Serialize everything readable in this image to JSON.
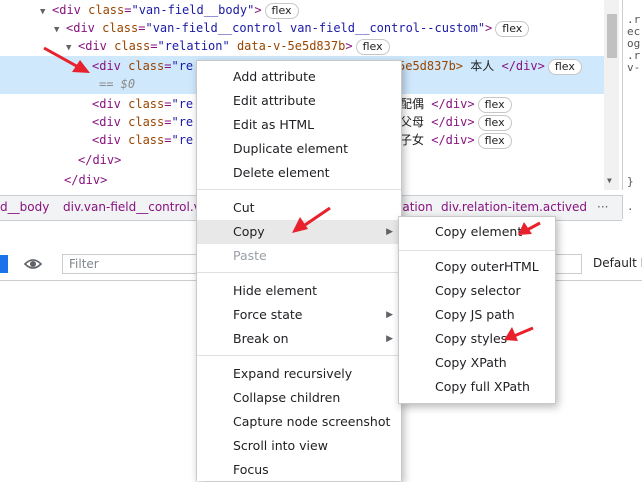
{
  "tree": {
    "line1": {
      "tag_open": "<div ",
      "attr": "class",
      "eq": "=",
      "val": "\"van-field__body\"",
      "tag_close": ">",
      "badge": "flex"
    },
    "line2": {
      "tag_open": "<div ",
      "attr": "class",
      "eq": "=",
      "val": "\"van-field__control van-field__control--custom\"",
      "tag_close": ">",
      "badge": "flex"
    },
    "line3": {
      "tag_open": "<div ",
      "attr": "class",
      "eq": "=",
      "val": "\"relation\"",
      "attr2": " data-v-5e5d837b",
      "tag_close": ">",
      "badge": "flex"
    },
    "line4": {
      "tag_open": "<div ",
      "attr": "class",
      "eq": "=",
      "val": "\"re",
      "tail": "5e5d837b>",
      "text": " 本人 ",
      "tag_end": "</div>",
      "badge": "flex"
    },
    "line4b": {
      "dollar": "== $0"
    },
    "line5": {
      "tag_open": "<div ",
      "attr": "class",
      "eq": "=",
      "val": "\"re",
      "text": " 配偶 ",
      "tag_end": "</div>",
      "badge": "flex"
    },
    "line6": {
      "tag_open": "<div ",
      "attr": "class",
      "eq": "=",
      "val": "\"re",
      "text": " 父母 ",
      "tag_end": "</div>",
      "badge": "flex"
    },
    "line7": {
      "tag_open": "<div ",
      "attr": "class",
      "eq": "=",
      "val": "\"re",
      "text": " 子女 ",
      "tag_end": "</div>",
      "badge": "flex"
    },
    "line8": {
      "tag_end": "</div>"
    },
    "line9": {
      "tag_end": "</div>"
    }
  },
  "styles_pane": {
    "lines": [
      ".r",
      "ec",
      "og",
      ".r",
      "v-",
      "",
      "",
      "",
      "",
      "",
      "",
      "",
      "",
      "",
      "}"
    ]
  },
  "breadcrumb": {
    "items": [
      "d__body",
      "div.van-field__control.v",
      "lation",
      "div.relation-item.actived"
    ],
    "more": "···",
    "right": "."
  },
  "filter": {
    "placeholder": "Filter",
    "right_label": "Default l"
  },
  "context_menu": {
    "items": [
      {
        "label": "Add attribute"
      },
      {
        "label": "Edit attribute"
      },
      {
        "label": "Edit as HTML"
      },
      {
        "label": "Duplicate element"
      },
      {
        "label": "Delete element"
      },
      {
        "label": "Cut"
      },
      {
        "label": "Copy"
      },
      {
        "label": "Paste"
      },
      {
        "label": "Hide element"
      },
      {
        "label": "Force state"
      },
      {
        "label": "Break on"
      },
      {
        "label": "Expand recursively"
      },
      {
        "label": "Collapse children"
      },
      {
        "label": "Capture node screenshot"
      },
      {
        "label": "Scroll into view"
      },
      {
        "label": "Focus"
      }
    ]
  },
  "copy_submenu": {
    "items": [
      {
        "label": "Copy element"
      },
      {
        "label": "Copy outerHTML"
      },
      {
        "label": "Copy selector"
      },
      {
        "label": "Copy JS path"
      },
      {
        "label": "Copy styles"
      },
      {
        "label": "Copy XPath"
      },
      {
        "label": "Copy full XPath"
      }
    ]
  },
  "icons": {
    "expand": "triangle-down-icon",
    "submenu": "triangle-right-icon",
    "eye": "eye-icon"
  },
  "colors": {
    "tag": "#881280",
    "attr": "#994500",
    "value": "#1a1aa6",
    "selection": "#cfe8fc",
    "arrow": "#e8212c"
  }
}
